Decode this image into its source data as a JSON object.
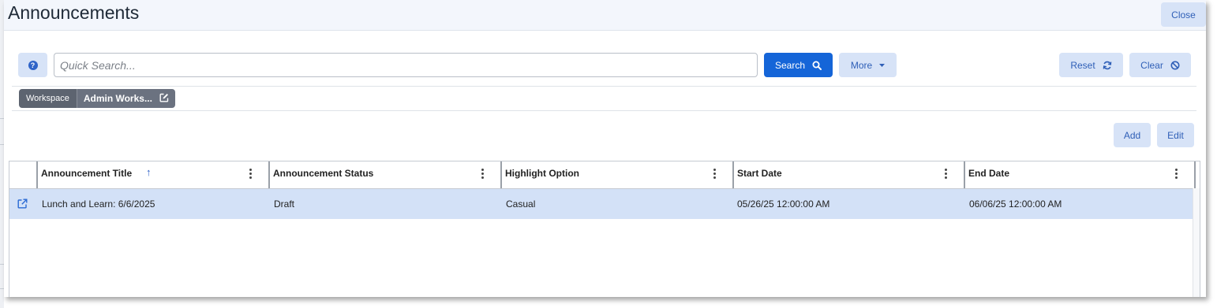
{
  "dialog": {
    "title": "Announcements",
    "close_label": "Close"
  },
  "search": {
    "placeholder": "Quick Search...",
    "value": "",
    "search_label": "Search",
    "more_label": "More",
    "reset_label": "Reset",
    "clear_label": "Clear",
    "help_icon": "question-circle-icon"
  },
  "filter_chip": {
    "label": "Workspace",
    "value": "Admin Works..."
  },
  "actions": {
    "add_label": "Add",
    "edit_label": "Edit"
  },
  "grid": {
    "columns": [
      "Announcement Title",
      "Announcement Status",
      "Highlight Option",
      "Start Date",
      "End Date"
    ],
    "sorted_column": "Announcement Title",
    "sort_direction": "ascending",
    "rows": [
      {
        "title": "Lunch and Learn: 6/6/2025",
        "status": "Draft",
        "highlight": "Casual",
        "start_date": "05/26/25 12:00:00 AM",
        "end_date": "06/06/25 12:00:00 AM",
        "selected": true
      }
    ]
  },
  "colors": {
    "primary": "#1565d8",
    "secondary_button": "#d7e3f7",
    "selected_row": "#d3e1f7",
    "chip": "#5d6470"
  }
}
